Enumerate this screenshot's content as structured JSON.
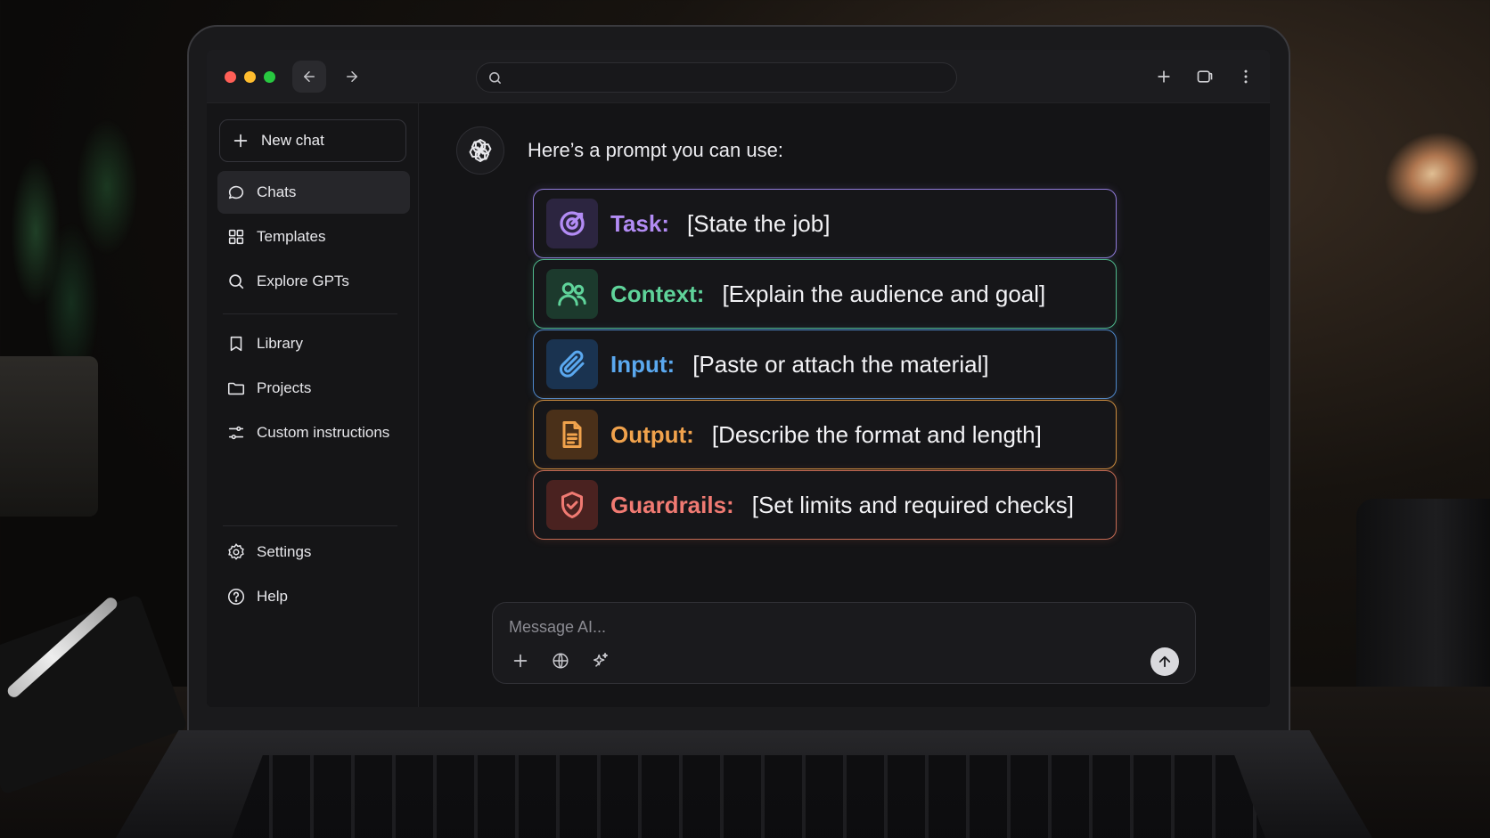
{
  "sidebar": {
    "new_chat": "New chat",
    "items": [
      {
        "label": "Chats",
        "icon": "chat-bubble-icon",
        "active": true
      },
      {
        "label": "Templates",
        "icon": "grid-icon"
      },
      {
        "label": "Explore GPTs",
        "icon": "search-icon"
      },
      {
        "label": "Library",
        "icon": "bookmark-icon"
      },
      {
        "label": "Projects",
        "icon": "folder-icon"
      },
      {
        "label": "Custom instructions",
        "icon": "sliders-icon"
      },
      {
        "label": "Settings",
        "icon": "gear-icon"
      },
      {
        "label": "Help",
        "icon": "help-circle-icon"
      }
    ]
  },
  "chat": {
    "intro": "Here’s a prompt you can use:",
    "cards": [
      {
        "label": "Task:",
        "text": "[State the job]",
        "icon": "target-icon",
        "color": "#b38cf5",
        "border": "#8f7ad8",
        "icon_bg": "#2c2540"
      },
      {
        "label": "Context:",
        "text": "[Explain the audience and goal]",
        "icon": "users-icon",
        "color": "#5fd39a",
        "border": "#4fb88c",
        "icon_bg": "#1c3a2d"
      },
      {
        "label": "Input:",
        "text": "[Paste or attach the material]",
        "icon": "paperclip-icon",
        "color": "#5aa8ef",
        "border": "#4d86c9",
        "icon_bg": "#1a3350"
      },
      {
        "label": "Output:",
        "text": "[Describe the format and length]",
        "icon": "document-icon",
        "color": "#f0a24c",
        "border": "#c98a3e",
        "icon_bg": "#4a3019"
      },
      {
        "label": "Guardrails:",
        "text": "[Set limits and required checks]",
        "icon": "shield-check-icon",
        "color": "#f07a72",
        "border": "#c46a53",
        "icon_bg": "#4a2220"
      }
    ]
  },
  "composer": {
    "placeholder": "Message AI...",
    "tools": [
      "plus-icon",
      "globe-icon",
      "sparkles-icon"
    ],
    "send_icon": "arrow-up-icon"
  },
  "browser": {
    "address_value": ""
  }
}
